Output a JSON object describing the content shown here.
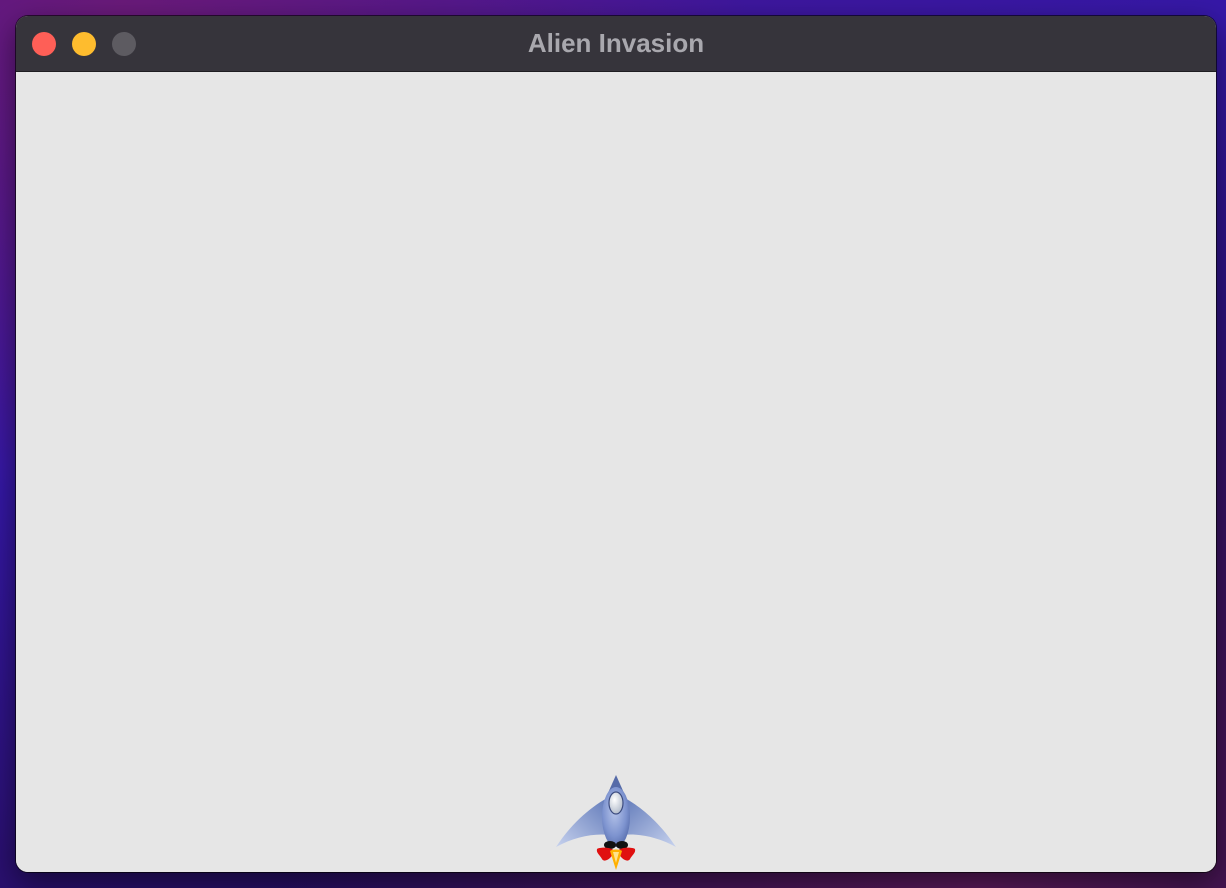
{
  "window": {
    "title": "Alien Invasion",
    "controls": {
      "close_icon": "close-icon",
      "minimize_icon": "minimize-icon",
      "zoom_icon": "zoom-icon"
    }
  },
  "game": {
    "background_color": "#e6e6e6",
    "ship_icon": "spaceship-icon",
    "ship_colors": {
      "hull": "#7f95cf",
      "window": "#d8dde6",
      "flame": "#e01010",
      "flame_core": "#ffb000"
    }
  }
}
